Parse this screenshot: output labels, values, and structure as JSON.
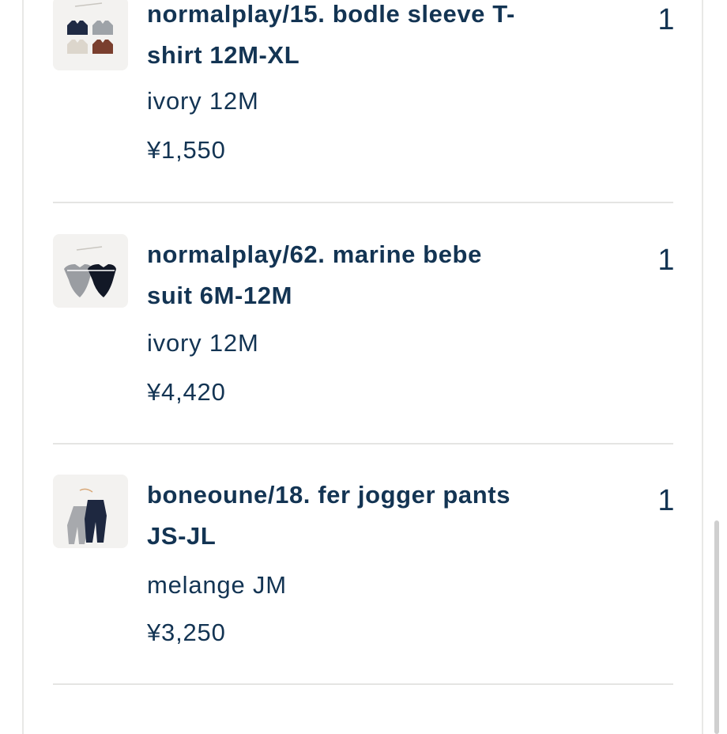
{
  "cart": {
    "items": [
      {
        "title_line1": "normalplay/15. bodle sleeve T-",
        "title_line2": "shirt 12M-XL",
        "variant": "ivory 12M",
        "price": "¥1,550",
        "quantity": "1",
        "thumbnail_icon": "tank-tops-product-photo"
      },
      {
        "title_line1": "normalplay/62. marine bebe",
        "title_line2": "suit 6M-12M",
        "variant": "ivory 12M",
        "price": "¥4,420",
        "quantity": "1",
        "thumbnail_icon": "bodysuits-product-photo"
      },
      {
        "title_line1": "boneoune/18. fer jogger pants",
        "title_line2": "JS-JL",
        "variant": "melange JM",
        "price": "¥3,250",
        "quantity": "1",
        "thumbnail_icon": "jogger-pants-product-photo"
      }
    ]
  },
  "colors": {
    "text": "#133453",
    "divider": "#e5e5e3",
    "thumbnail_bg": "#f3f2f0"
  }
}
